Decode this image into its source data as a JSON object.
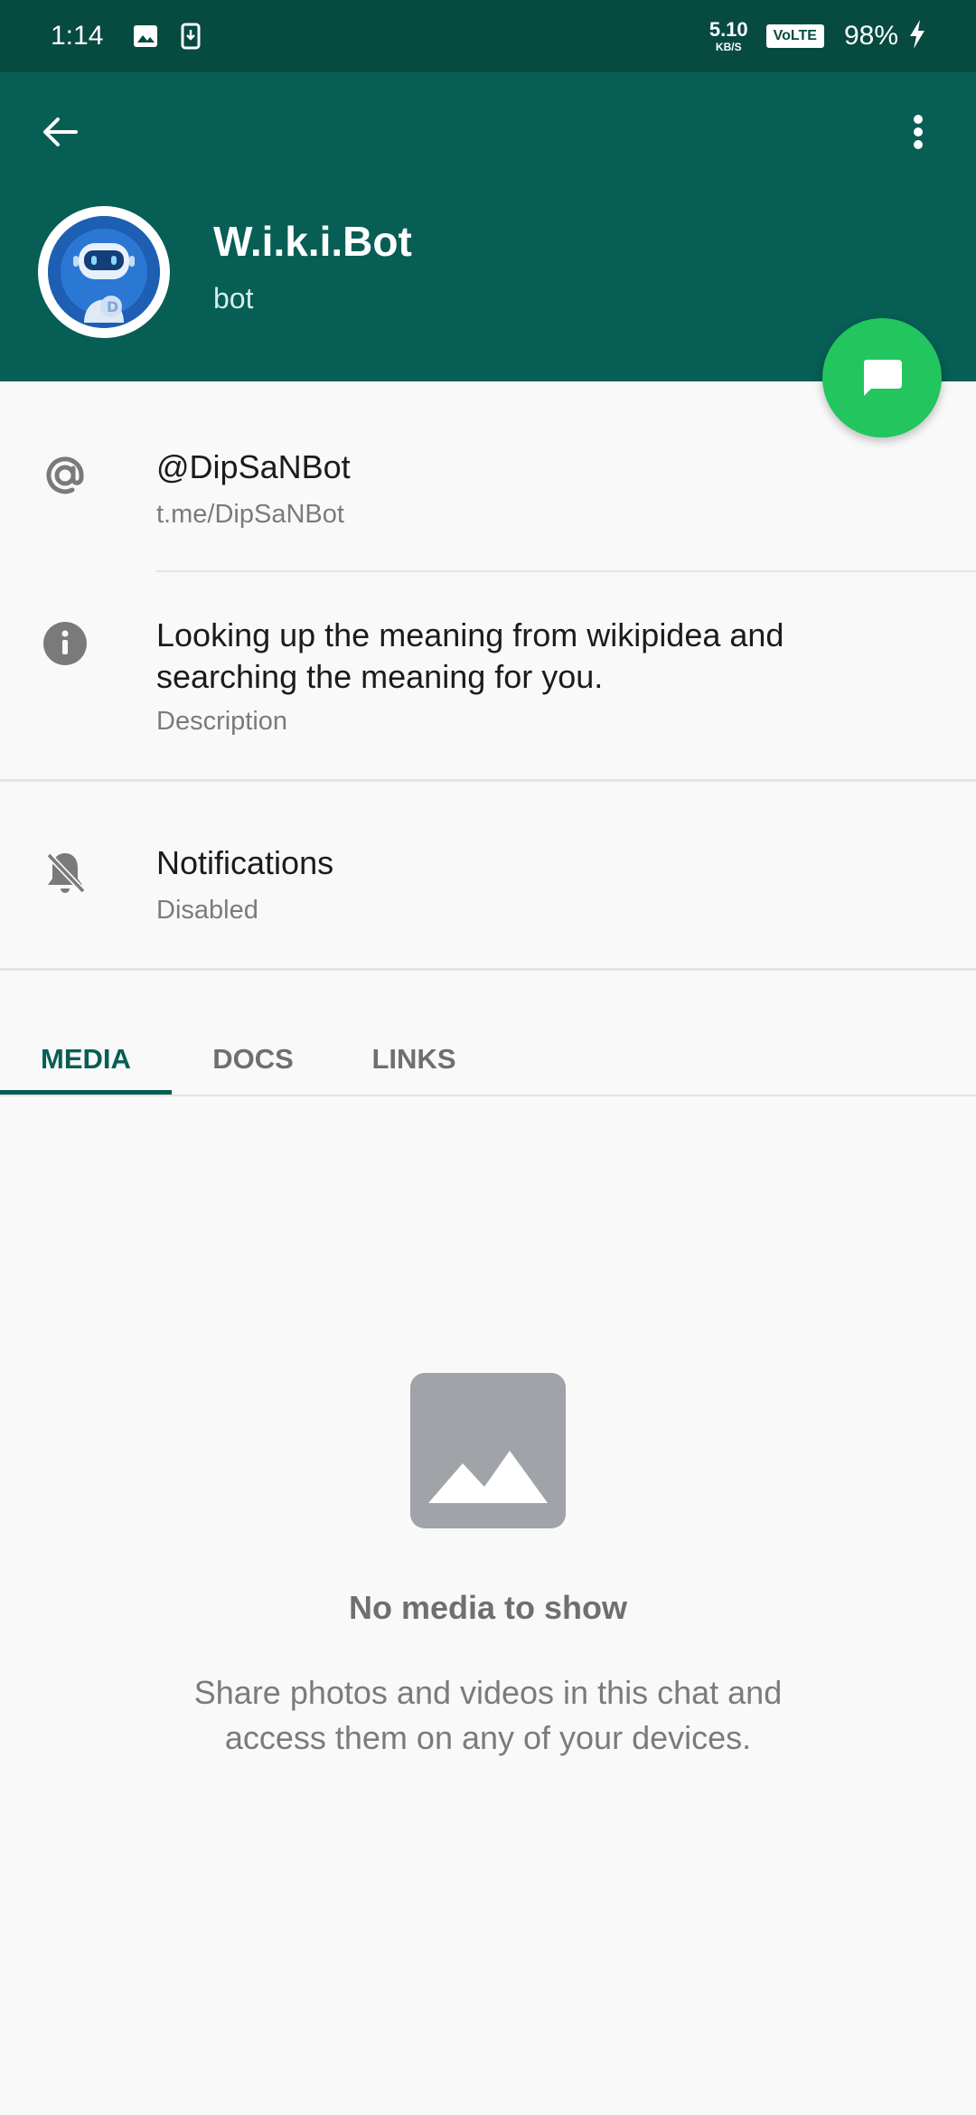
{
  "status_bar": {
    "time": "1:14",
    "speed_value": "5.10",
    "speed_unit": "KB/S",
    "volte": "VoLTE",
    "battery": "98%"
  },
  "header": {
    "title": "W.i.k.i.Bot",
    "subtitle": "bot",
    "bg_color": "#075e54"
  },
  "info": {
    "username": "@DipSaNBot",
    "username_link": "t.me/DipSaNBot",
    "description": "Looking up the meaning from wikipidea and searching the meaning for you.",
    "description_label": "Description"
  },
  "notifications": {
    "label": "Notifications",
    "status": "Disabled"
  },
  "tabs": [
    {
      "label": "MEDIA",
      "active": true
    },
    {
      "label": "DOCS",
      "active": false
    },
    {
      "label": "LINKS",
      "active": false
    }
  ],
  "empty_state": {
    "title": "No media to show",
    "description": "Share photos and videos in this chat and access them on any of your devices."
  },
  "colors": {
    "accent": "#075e54",
    "fab": "#22c55e",
    "status_bar": "#064a40"
  },
  "icons": {
    "back": "arrow-left-icon",
    "menu": "more-vert-icon",
    "fab": "chat-icon",
    "username": "at-sign-icon",
    "description": "info-icon",
    "notifications": "bell-off-icon",
    "empty": "image-icon"
  }
}
